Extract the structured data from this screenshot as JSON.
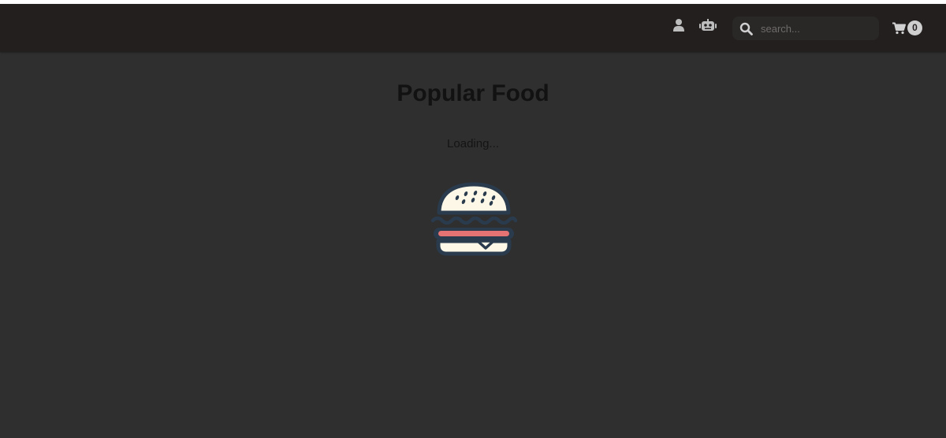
{
  "navbar": {
    "icons": [
      "user-icon",
      "robot-icon"
    ],
    "search": {
      "icon": "search-icon",
      "placeholder": "search..."
    },
    "cart": {
      "icon": "cart-icon",
      "count": "0"
    }
  },
  "main": {
    "title": "Popular Food",
    "status": "Loading...",
    "loader_icon": "burger-icon"
  },
  "colors": {
    "background": "#2f2f2f",
    "navbar": "#231f1f",
    "icon": "#bdbdbd",
    "bun": "#fdf7e8",
    "outline": "#2a3b4d",
    "patty_stripe": "#e57373"
  }
}
